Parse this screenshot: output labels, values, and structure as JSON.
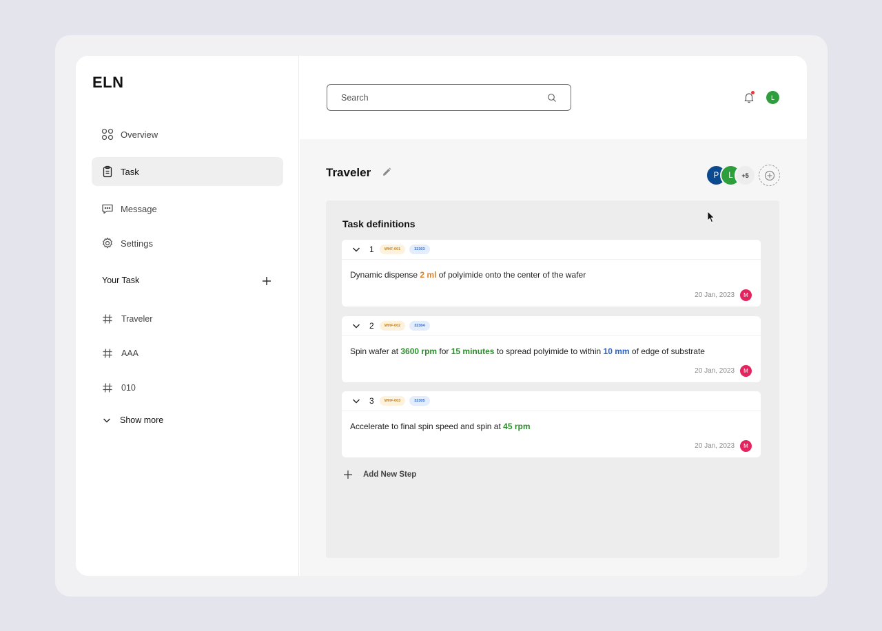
{
  "app": {
    "logo": "ELN"
  },
  "sidebar": {
    "nav": [
      {
        "label": "Overview",
        "icon": "grid-icon"
      },
      {
        "label": "Task",
        "icon": "clipboard-icon",
        "active": true
      },
      {
        "label": "Message",
        "icon": "chat-icon"
      },
      {
        "label": "Settings",
        "icon": "gear-icon"
      }
    ],
    "your_task_label": "Your Task",
    "channels": [
      {
        "label": "Traveler"
      },
      {
        "label": "AAA"
      },
      {
        "label": "010"
      }
    ],
    "show_more": "Show more"
  },
  "header": {
    "search_placeholder": "Search",
    "user_initial": "L"
  },
  "page": {
    "title": "Traveler",
    "members": [
      {
        "initial": "P",
        "color": "#0b4a8f"
      },
      {
        "initial": "L",
        "color": "#2e9e3d"
      }
    ],
    "more_members": "+5"
  },
  "panel": {
    "title": "Task definitions",
    "steps": [
      {
        "num": "1",
        "tag1": "WHF-001",
        "tag2": "32303",
        "text": {
          "t1": "Dynamic dispense ",
          "v1": "2 ml",
          "t2": " of polyimide onto the center of the wafer"
        },
        "date": "20 Jan, 2023",
        "user": "M"
      },
      {
        "num": "2",
        "tag1": "WHF-002",
        "tag2": "32304",
        "text": {
          "t1": "Spin wafer at ",
          "v1": "3600 rpm",
          "t2": " for ",
          "v2": "15 minutes",
          "t3": " to spread polyimide to within ",
          "v3": "10 mm",
          "t4": " of edge of substrate"
        },
        "date": "20 Jan, 2023",
        "user": "M"
      },
      {
        "num": "3",
        "tag1": "WHF-003",
        "tag2": "32305",
        "text": {
          "t1": "Accelerate to final spin speed and spin at ",
          "v1": "45 rpm"
        },
        "date": "20 Jan, 2023",
        "user": "M"
      }
    ],
    "add_step": "Add New Step"
  },
  "colors": {
    "accent_orange": "#d9822b",
    "accent_green": "#2f8a2f",
    "accent_blue": "#2863c5",
    "user_badge": "#e3245e"
  }
}
